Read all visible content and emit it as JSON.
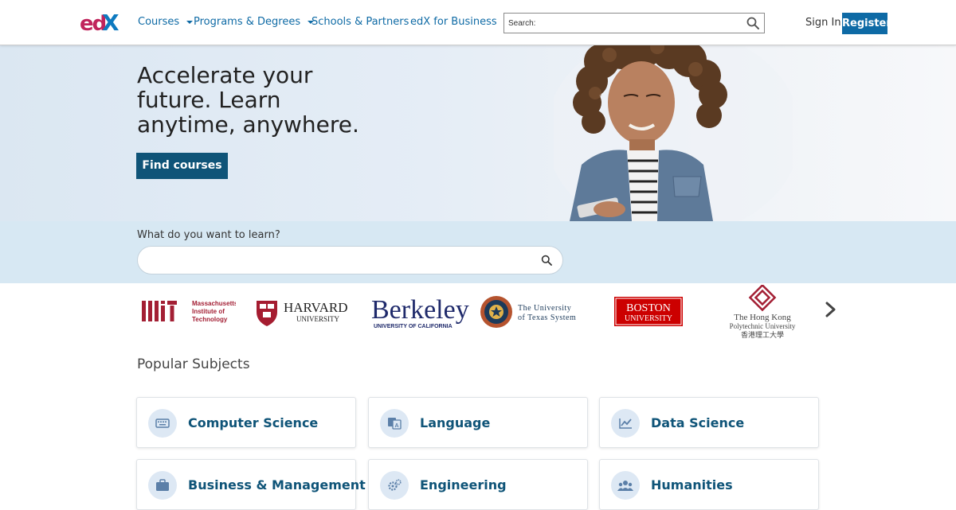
{
  "header": {
    "brand": "edX",
    "nav": [
      {
        "label": "Courses",
        "dropdown": true
      },
      {
        "label": "Programs & Degrees",
        "dropdown": true
      },
      {
        "label": "Schools & Partners",
        "dropdown": false
      },
      {
        "label": "edX for Business",
        "dropdown": false
      }
    ],
    "search_placeholder": "Search:",
    "signin_label": "Sign In",
    "register_label": "Register"
  },
  "hero": {
    "headline_lines": [
      "Accelerate your",
      "future. Learn",
      "anytime, anywhere."
    ],
    "cta_label": "Find courses"
  },
  "learn": {
    "label": "What do you want to learn?",
    "input_value": ""
  },
  "partners": {
    "mit": {
      "lines": [
        "Massachusetts",
        "Institute of",
        "Technology"
      ]
    },
    "harvard": {
      "name": "HARVARD",
      "sub": "UNIVERSITY"
    },
    "berkeley": {
      "name": "Berkeley",
      "sub": "UNIVERSITY OF CALIFORNIA"
    },
    "texas": {
      "line1": "The University",
      "line2": "of Texas System"
    },
    "boston": {
      "line1": "BOSTON",
      "line2": "UNIVERSITY"
    },
    "polyu": {
      "line1": "The Hong Kong",
      "line2": "Polytechnic University",
      "line3": "香港理工大學"
    }
  },
  "popular": {
    "title": "Popular Subjects",
    "subjects": [
      {
        "label": "Computer Science",
        "icon": "keyboard-icon"
      },
      {
        "label": "Language",
        "icon": "translate-icon"
      },
      {
        "label": "Data Science",
        "icon": "chart-line-icon"
      },
      {
        "label": "Business & Management",
        "icon": "briefcase-icon"
      },
      {
        "label": "Engineering",
        "icon": "gears-icon"
      },
      {
        "label": "Humanities",
        "icon": "people-icon"
      }
    ]
  },
  "colors": {
    "brand_blue": "#0e6aa5",
    "cta_navy": "#0f5478",
    "accent_magenta": "#c0245c",
    "mit_red": "#a31f34",
    "harvard_crimson": "#a51c30",
    "berkeley_navy": "#1f2a6b",
    "bu_red": "#cc0000"
  }
}
